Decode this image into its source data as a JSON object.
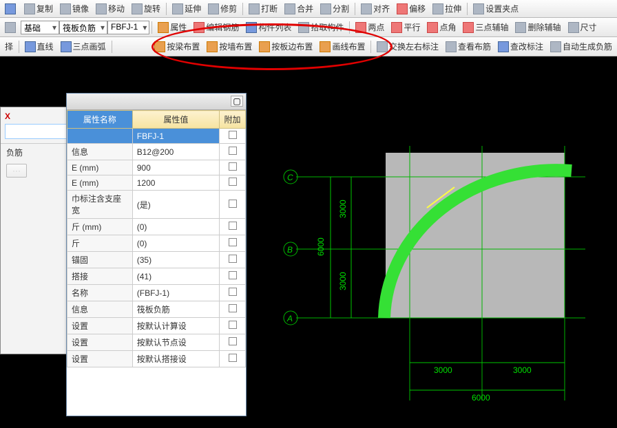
{
  "toolbar1": {
    "copy": "复制",
    "mirror": "镜像",
    "move": "移动",
    "rotate": "旋转",
    "extend": "延伸",
    "trim": "修剪",
    "break": "打断",
    "merge": "合并",
    "split": "分割",
    "align": "对齐",
    "offset": "偏移",
    "stretch": "拉伸",
    "setgrip": "设置夹点"
  },
  "toolbar2": {
    "base": "基础",
    "slabrebar": "筏板负筋",
    "fbfj": "FBFJ-1",
    "attr": "属性",
    "editrebar": "编辑钢筋",
    "complist": "构件列表",
    "pickcomp": "拾取构件",
    "twopt": "两点",
    "parallel": "平行",
    "ptangle": "点角",
    "threeaxis": "三点辅轴",
    "delaxis": "删除辅轴",
    "dim": "尺寸"
  },
  "toolbar3": {
    "select": "择",
    "line": "直线",
    "threearc": "三点画弧",
    "bybeam": "按梁布置",
    "bywall": "按墙布置",
    "byslab": "按板边布置",
    "byline": "画线布置",
    "swapmark": "交换左右标注",
    "viewrebar": "查看布筋",
    "viewmark": "查改标注",
    "autoneg": "自动生成负筋"
  },
  "prop": {
    "col_name": "属性名称",
    "col_val": "属性值",
    "col_extra": "附加",
    "rows": [
      {
        "k": "",
        "v": "FBFJ-1",
        "sel": true
      },
      {
        "k": "信息",
        "v": "B12@200"
      },
      {
        "k": "E (mm)",
        "v": "900"
      },
      {
        "k": "E (mm)",
        "v": "1200"
      },
      {
        "k": "巾标注含支座宽",
        "v": "(是)"
      },
      {
        "k": "斤 (mm)",
        "v": "(0)"
      },
      {
        "k": "斤",
        "v": "(0)"
      },
      {
        "k": "锚固",
        "v": "(35)"
      },
      {
        "k": "搭接",
        "v": "(41)"
      },
      {
        "k": "名称",
        "v": "(FBFJ-1)"
      },
      {
        "k": "信息",
        "v": "筏板负筋"
      },
      {
        "k": "设置",
        "v": "按默认计算设"
      },
      {
        "k": "设置",
        "v": "按默认节点设"
      },
      {
        "k": "设置",
        "v": "按默认搭接设"
      }
    ]
  },
  "search": {
    "item": "负筋"
  },
  "axes": {
    "A": "A",
    "B": "B",
    "C": "C",
    "d3000a": "3000",
    "d3000b": "3000",
    "d3000c": "3000",
    "d3000d": "3000",
    "d6000a": "6000",
    "d6000b": "6000"
  }
}
